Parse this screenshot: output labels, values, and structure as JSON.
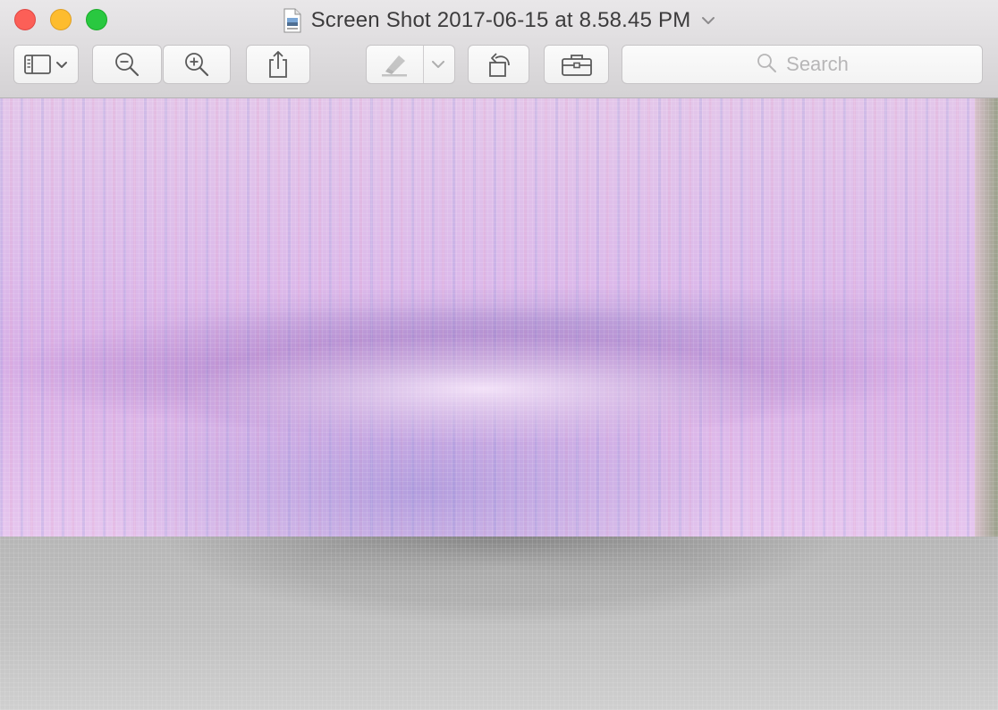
{
  "window": {
    "title": "Screen Shot 2017-06-15 at 8.58.45 PM",
    "app_icon": "preview-document-icon",
    "title_menu_icon": "chevron-down-icon"
  },
  "toolbar": {
    "buttons": [
      {
        "name": "sidebar-view-button",
        "icon": "sidebar-icon",
        "has_menu": true
      },
      {
        "name": "zoom-out-button",
        "icon": "zoom-out-icon"
      },
      {
        "name": "zoom-in-button",
        "icon": "zoom-in-icon"
      },
      {
        "name": "share-button",
        "icon": "share-icon"
      },
      {
        "name": "markup-button",
        "icon": "highlighter-icon",
        "has_menu": true,
        "enabled": false
      },
      {
        "name": "rotate-button",
        "icon": "rotate-left-icon"
      },
      {
        "name": "markup-toolbar-button",
        "icon": "toolbox-icon"
      }
    ],
    "search": {
      "placeholder": "Search",
      "icon": "search-icon"
    }
  },
  "colors": {
    "close": "#fc5f57",
    "minimize": "#fdbc2e",
    "zoom": "#29c840",
    "titlebar": "#e3e1e3",
    "title_text": "#3c3b3c"
  },
  "content": {
    "image_description_icon": "photo-image"
  }
}
